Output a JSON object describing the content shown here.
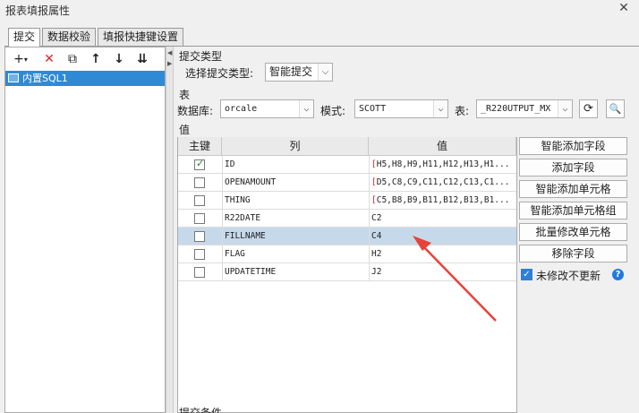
{
  "window": {
    "title": "报表填报属性"
  },
  "tabs": [
    {
      "label": "提交",
      "active": true
    },
    {
      "label": "数据校验",
      "active": false
    },
    {
      "label": "填报快捷键设置",
      "active": false
    }
  ],
  "left": {
    "tree_item": "内置SQL1"
  },
  "submit_type": {
    "section": "提交类型",
    "label": "选择提交类型:",
    "value": "智能提交"
  },
  "table_section": {
    "section": "表",
    "db_label": "数据库:",
    "db_value": "orcale",
    "schema_label": "模式:",
    "schema_value": "SCOTT",
    "table_label": "表:",
    "table_value": "_R220UTPUT_MX"
  },
  "value_section": {
    "section": "值",
    "headers": {
      "key": "主键",
      "col": "列",
      "val": "值"
    },
    "rows": [
      {
        "key": true,
        "col": "ID",
        "val": "[H5,H8,H9,H11,H12,H13,H1..."
      },
      {
        "key": false,
        "col": "OPENAMOUNT",
        "val": "[D5,C8,C9,C11,C12,C13,C1..."
      },
      {
        "key": false,
        "col": "THING",
        "val": "[C5,B8,B9,B11,B12,B13,B1..."
      },
      {
        "key": false,
        "col": "R22DATE",
        "val": "C2"
      },
      {
        "key": false,
        "col": "FILLNAME",
        "val": "C4"
      },
      {
        "key": false,
        "col": "FLAG",
        "val": "H2"
      },
      {
        "key": false,
        "col": "UPDATETIME",
        "val": "J2"
      }
    ]
  },
  "buttons": {
    "smart_add_field": "智能添加字段",
    "add_field": "添加字段",
    "smart_add_cell": "智能添加单元格",
    "smart_add_cell_group": "智能添加单元格组",
    "batch_edit_cell": "批量修改单元格",
    "remove_field": "移除字段"
  },
  "no_update_unchanged": {
    "label": "未修改不更新",
    "checked": true
  },
  "bottom_section": "提交条件",
  "colors": {
    "selection": "#2f8ad6",
    "row_highlight": "#c6d9ea",
    "arrow": "#e8423a",
    "delete": "#d9262c"
  }
}
